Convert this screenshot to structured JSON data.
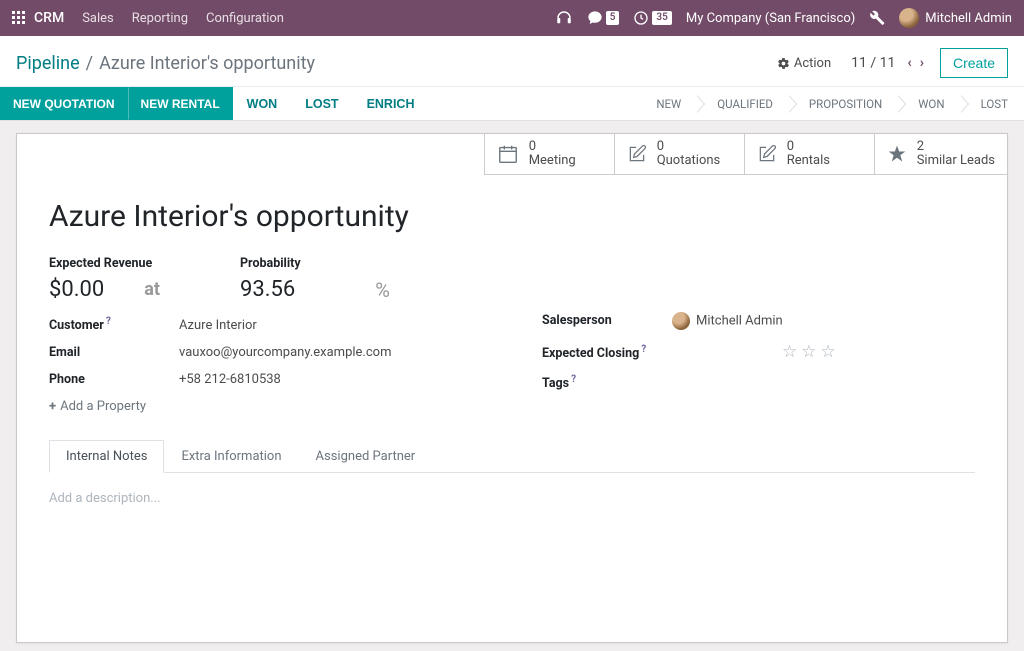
{
  "topnav": {
    "brand": "CRM",
    "menus": [
      "Sales",
      "Reporting",
      "Configuration"
    ],
    "messages_badge": "5",
    "activities_badge": "35",
    "company": "My Company (San Francisco)",
    "user": "Mitchell Admin"
  },
  "header": {
    "breadcrumb_root": "Pipeline",
    "breadcrumb_current": "Azure Interior's opportunity",
    "action_label": "Action",
    "pager": "11 / 11",
    "create_label": "Create"
  },
  "buttons": {
    "new_quotation": "NEW QUOTATION",
    "new_rental": "NEW RENTAL",
    "won": "WON",
    "lost": "LOST",
    "enrich": "ENRICH"
  },
  "stages": [
    "NEW",
    "QUALIFIED",
    "PROPOSITION",
    "WON",
    "LOST"
  ],
  "stat_buttons": [
    {
      "value": "0",
      "label": "Meeting",
      "icon": "calendar"
    },
    {
      "value": "0",
      "label": "Quotations",
      "icon": "edit"
    },
    {
      "value": "0",
      "label": "Rentals",
      "icon": "edit"
    },
    {
      "value": "2",
      "label": "Similar Leads",
      "icon": "star"
    }
  ],
  "record": {
    "title": "Azure Interior's opportunity",
    "expected_revenue_label": "Expected Revenue",
    "expected_revenue": "$0.00",
    "at": "at",
    "probability_label": "Probability",
    "probability": "93.56",
    "percent": "%",
    "customer_label": "Customer",
    "customer": "Azure Interior",
    "email_label": "Email",
    "email": "vauxoo@yourcompany.example.com",
    "phone_label": "Phone",
    "phone": "+58 212-6810538",
    "add_property": "Add a Property",
    "salesperson_label": "Salesperson",
    "salesperson": "Mitchell Admin",
    "expected_closing_label": "Expected Closing",
    "tags_label": "Tags"
  },
  "tabs": {
    "items": [
      "Internal Notes",
      "Extra Information",
      "Assigned Partner"
    ],
    "active": 0,
    "description_placeholder": "Add a description..."
  }
}
